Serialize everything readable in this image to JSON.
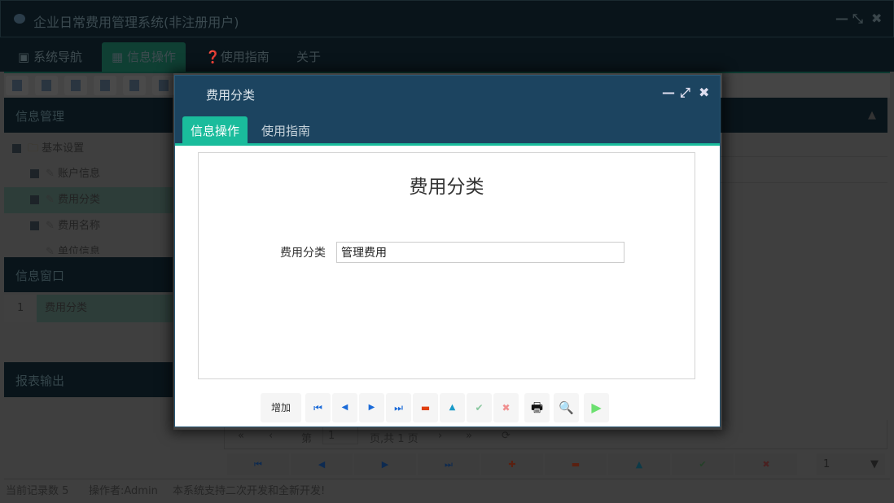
{
  "app": {
    "title": "企业日常费用管理系统(非注册用户)"
  },
  "menu": [
    {
      "label": "系统导航",
      "icon": "window-icon"
    },
    {
      "label": "信息操作",
      "icon": "grid-icon"
    },
    {
      "label": "使用指南",
      "icon": "help-icon"
    },
    {
      "label": "关于"
    }
  ],
  "left": {
    "info_manage": "信息管理",
    "tree": [
      {
        "label": "基本设置"
      },
      {
        "label": "账户信息"
      },
      {
        "label": "费用分类"
      },
      {
        "label": "费用名称"
      },
      {
        "label": "单位信息"
      }
    ],
    "info_window": "信息窗口",
    "window_rows": [
      {
        "num": "1",
        "label": "费用分类"
      }
    ],
    "report": "报表输出"
  },
  "pager": {
    "page_prefix": "第",
    "page": "1",
    "page_suffix": "页,共 1 页",
    "page_size": "1"
  },
  "status": {
    "records": "当前记录数 5",
    "operator": "操作者:Admin",
    "message": "本系统支持二次开发和全新开发!"
  },
  "dialog": {
    "title": "费用分类",
    "tabs": [
      "信息操作",
      "使用指南"
    ],
    "form_title": "费用分类",
    "field_label": "费用分类",
    "field_value": "管理费用",
    "add_label": "增加"
  },
  "colors": {
    "accent": "#1abc9c",
    "dialog_header": "#1c4460"
  }
}
